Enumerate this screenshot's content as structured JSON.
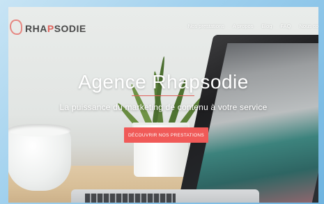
{
  "header": {
    "logo_prefix": "RHA",
    "logo_accent": "P",
    "logo_suffix": "SODIE",
    "nav": [
      "Nos prestations",
      "A propos",
      "Blog",
      "FAQ",
      "Nous co"
    ]
  },
  "hero": {
    "title": "Agence Rhapsodie",
    "subtitle": "La puissance du marketing de contenu à votre service",
    "cta_label": "DÉCOUVRIR NOS PRESTATIONS"
  },
  "colors": {
    "accent": "#f05a58",
    "logo_text": "#4a4a4a"
  }
}
